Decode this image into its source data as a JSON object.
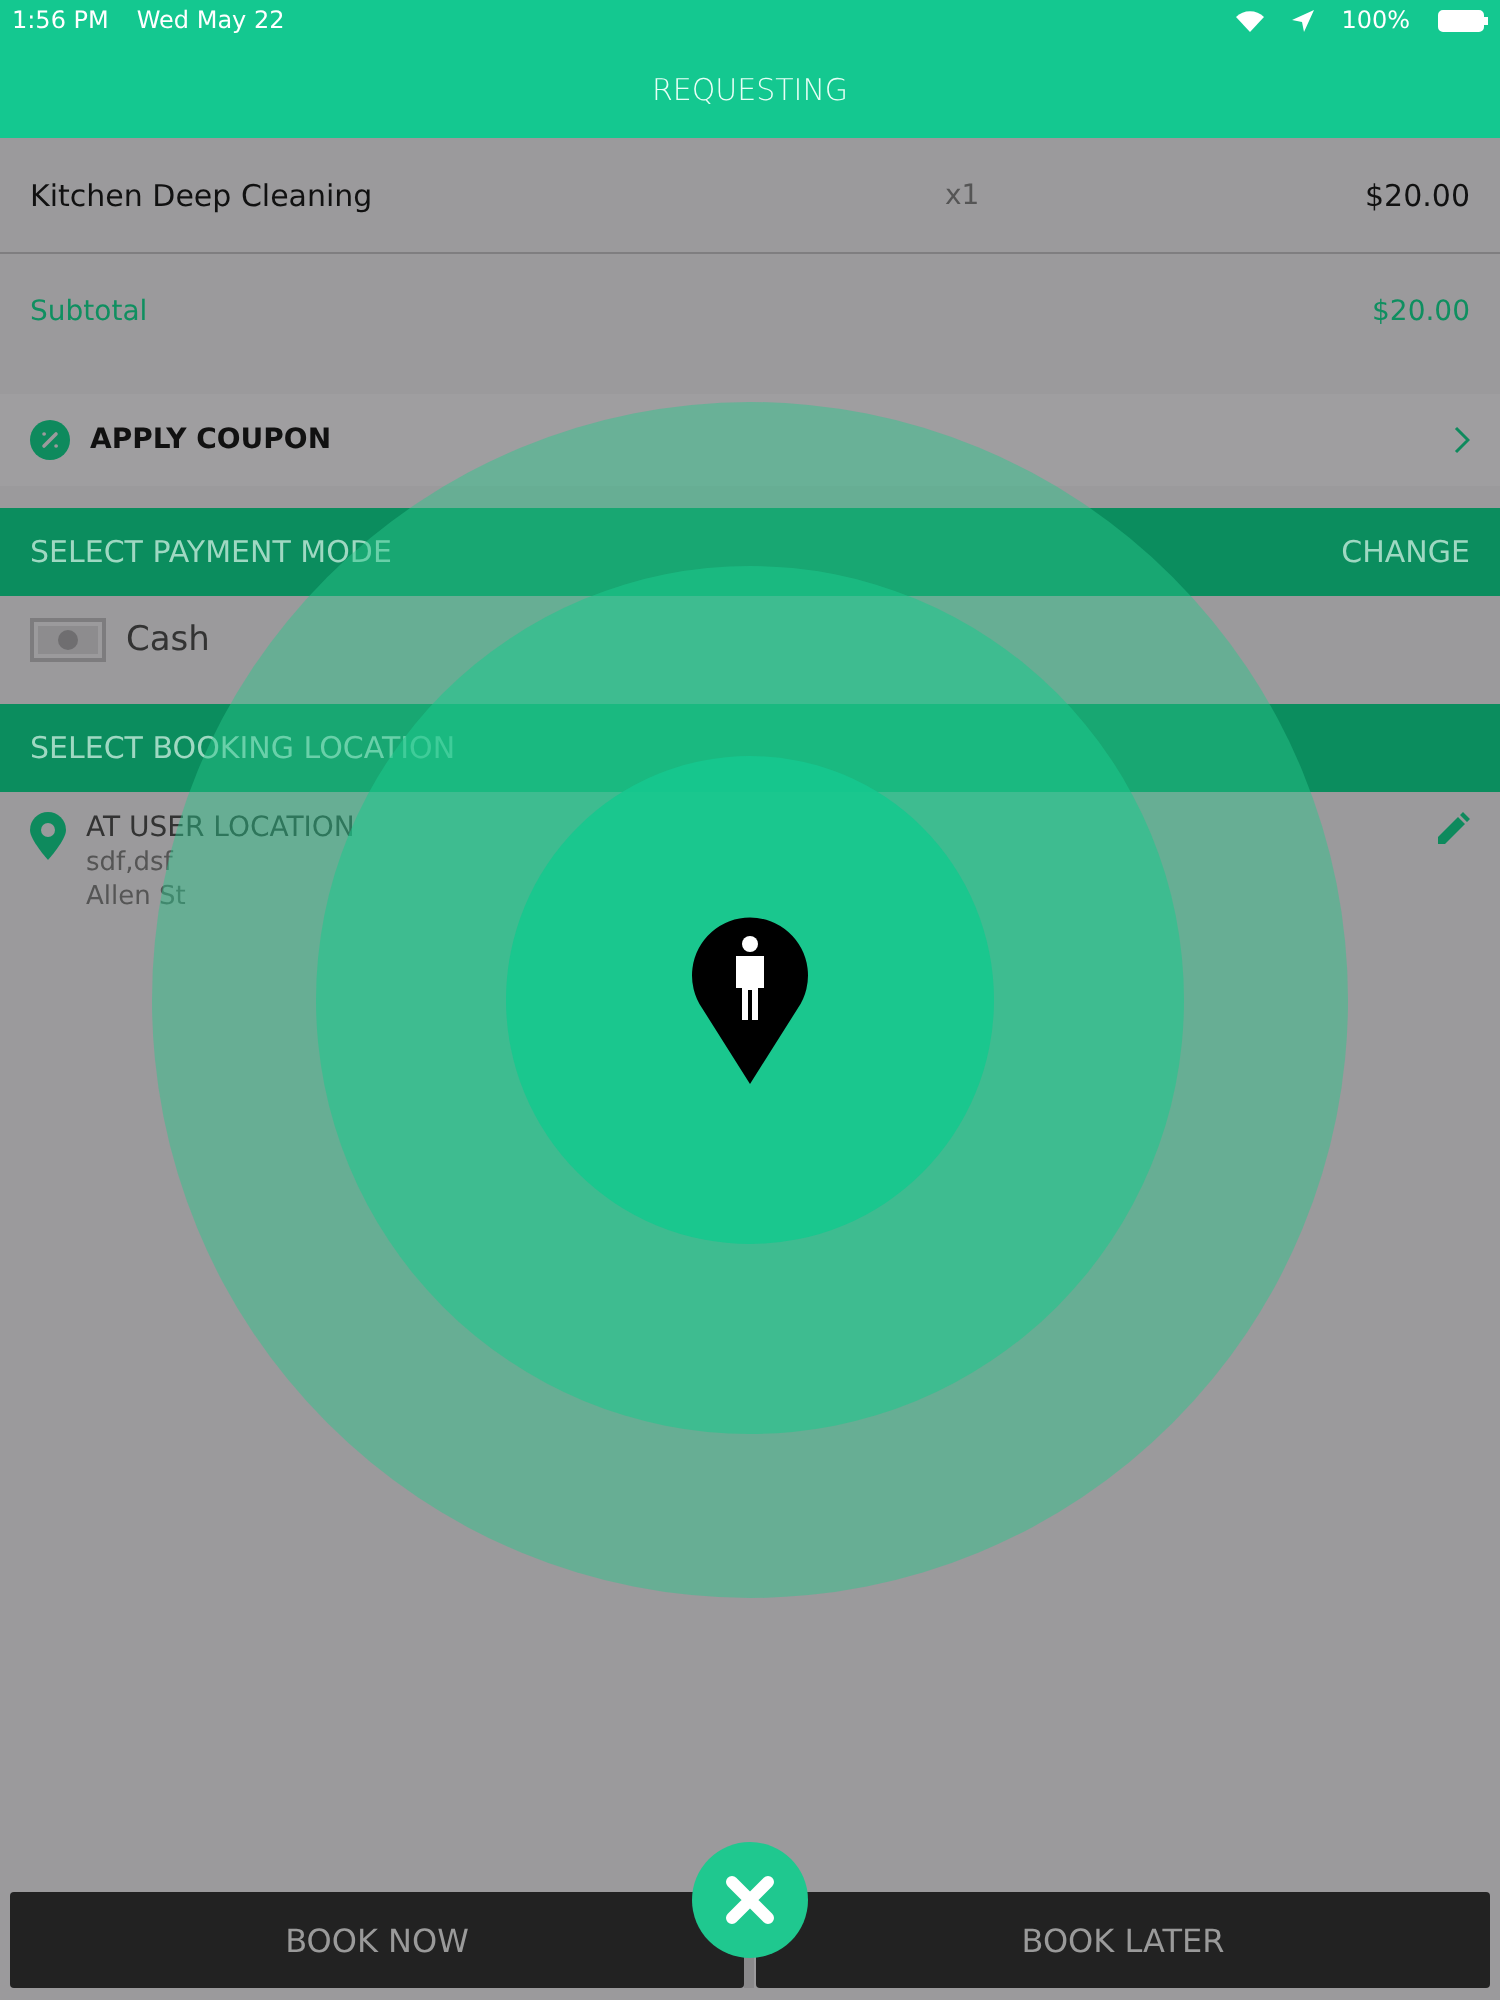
{
  "status_bar": {
    "time": "1:56 PM",
    "date": "Wed May 22",
    "battery": "100%"
  },
  "header": {
    "title": "REQUESTING"
  },
  "order_items": [
    {
      "name": "Kitchen Deep Cleaning",
      "quantity": "x1",
      "price": "$20.00"
    }
  ],
  "subtotal": {
    "label": "Subtotal",
    "amount": "$20.00"
  },
  "coupon": {
    "label": "APPLY COUPON"
  },
  "payment": {
    "heading": "SELECT PAYMENT MODE",
    "action": "CHANGE",
    "method": "Cash"
  },
  "location": {
    "heading": "SELECT BOOKING LOCATION",
    "title": "AT USER LOCATION",
    "lines": [
      "sdf,dsf",
      "Allen St"
    ]
  },
  "footer": {
    "buttons": [
      "BOOK NOW",
      "BOOK LATER"
    ]
  }
}
